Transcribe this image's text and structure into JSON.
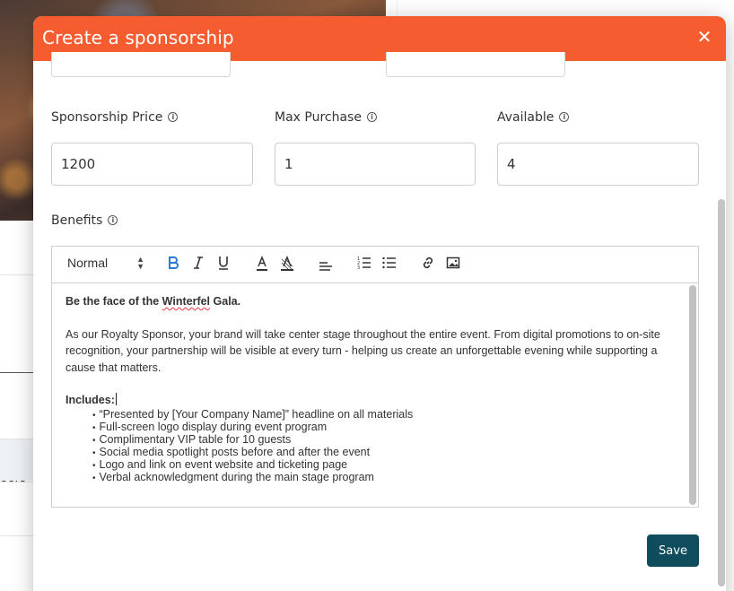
{
  "background": {
    "tab_partial_label": "eers"
  },
  "modal": {
    "title": "Create a sponsorship",
    "close_symbol": "✕",
    "fields": {
      "price": {
        "label": "Sponsorship Price",
        "value": "1200"
      },
      "max_purchase": {
        "label": "Max Purchase",
        "value": "1"
      },
      "available": {
        "label": "Available",
        "value": "4"
      }
    },
    "benefits": {
      "label": "Benefits",
      "toolbar": {
        "format_select": "Normal",
        "buttons": [
          "bold-icon",
          "italic-icon",
          "underline-icon",
          "text-color-icon",
          "highlight-icon",
          "align-icon",
          "ordered-list-icon",
          "bullet-list-icon",
          "link-icon",
          "image-icon"
        ]
      },
      "content": {
        "heading_prefix": "Be the face of the ",
        "heading_misspelled": "Winterfel",
        "heading_suffix": " Gala.",
        "paragraph": "As our Royalty Sponsor, your brand will take center stage throughout the entire event. From digital promotions to on-site recognition, your partnership will be visible at every turn - helping us create an unforgettable evening while supporting a cause that matters.",
        "includes_label": "Includes:",
        "items": [
          "“Presented by [Your Company Name]” headline on all materials",
          "Full-screen logo display during event program",
          "Complimentary VIP table for 10 guests",
          "Social media spotlight posts before and after the event",
          "Logo and link on event website and ticketing page",
          "Verbal acknowledgment during the main stage program"
        ]
      }
    },
    "save_label": "Save"
  },
  "colors": {
    "header": "#f55c2f",
    "save_button": "#0f4c5c",
    "info_icon": "#555555",
    "bold_icon_active": "#2a7ad6"
  }
}
